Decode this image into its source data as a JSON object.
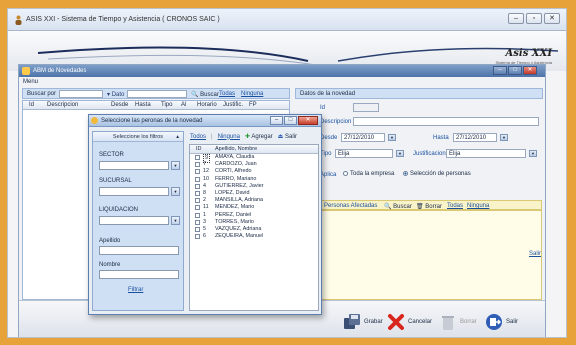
{
  "window": {
    "title": "ASIS XXI - Sistema de Tiempo y Asistencia ( CRONOS SAIC )",
    "brand": "Asis XXI",
    "brand_sub": "Sistema de Tiempo y Asistencia"
  },
  "abm": {
    "title": "ABM de Novedades",
    "menu": "Menu",
    "search": {
      "label_buscar_por": "Buscar por",
      "label_dato": "Dato",
      "buscar": "Buscar",
      "todas": "Todas",
      "ninguna": "Ninguna"
    },
    "columns": [
      "Id",
      "Descripcion",
      "Desde",
      "Hasta",
      "Tipo",
      "Al",
      "Horario",
      "Justific.",
      "FP"
    ],
    "detail": {
      "title": "Datos de la novedad",
      "label_id": "Id",
      "label_desc": "Descripcion",
      "label_desde": "Desde",
      "desde": "27/12/2010",
      "label_hasta": "Hasta",
      "hasta": "27/12/2010",
      "label_tipo": "Tipo",
      "tipo": "Elija",
      "label_justificacion": "Justificacion",
      "justificacion": "Elija",
      "label_aplica": "Aplica",
      "radio_empresa": "Toda la empresa",
      "radio_personas": "Selección de personas",
      "afectadas": "Personas Afectadas",
      "buscar": "Buscar",
      "borrar": "Borrar",
      "todas": "Todas",
      "ninguna": "Ninguna"
    },
    "salir_link": "Salir",
    "buttons": {
      "grabar": "Grabar",
      "cancelar": "Cancelar",
      "borrar": "Borrar",
      "salir": "Salir"
    }
  },
  "dialog": {
    "title": "Seleccione las peronas de la novedad",
    "filters_title": "Seleccione los filtros",
    "sector": "SECTOR",
    "sucursal": "SUCURSAL",
    "liquidacion": "LIQUIDACION",
    "apellido": "Apellido",
    "nombre": "Nombre",
    "filtrar": "Filtrar",
    "todos": "Todos",
    "ninguna": "Ninguna",
    "agregar": "Agregar",
    "salir": "Salir",
    "col_id": "ID",
    "col_name": "Apellido, Nombre",
    "people": [
      {
        "id": "9",
        "name": "AMAYA, Claudia"
      },
      {
        "id": "7",
        "name": "CARDOZO, Juan"
      },
      {
        "id": "12",
        "name": "CORTI, Alfredo"
      },
      {
        "id": "10",
        "name": "FERRO, Mariano"
      },
      {
        "id": "4",
        "name": "GUTIERREZ, Javier"
      },
      {
        "id": "8",
        "name": "LOPEZ, David"
      },
      {
        "id": "2",
        "name": "MANSILLA, Adriana"
      },
      {
        "id": "11",
        "name": "MENDEZ, Mario"
      },
      {
        "id": "1",
        "name": "PEREZ, Daniel"
      },
      {
        "id": "3",
        "name": "TORRES, Mario"
      },
      {
        "id": "5",
        "name": "VAZQUEZ, Adriana"
      },
      {
        "id": "6",
        "name": "ZEQUEIRA, Manuel"
      }
    ]
  }
}
